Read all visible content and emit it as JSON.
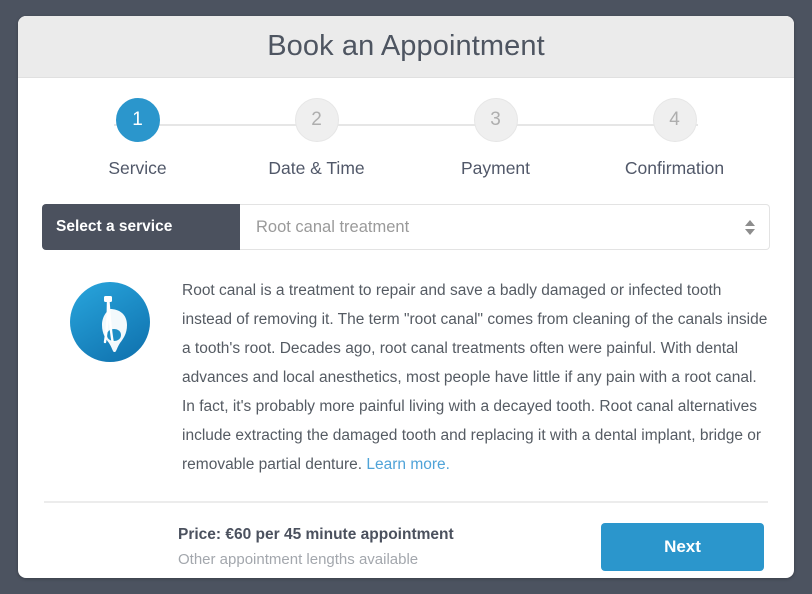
{
  "window": {
    "background_color": "#4c5360",
    "card_background": "#ffffff"
  },
  "header": {
    "title": "Book an Appointment",
    "background_color": "#ebebeb"
  },
  "stepper": {
    "active_color": "#2b96cc",
    "inactive_color": "#efefef",
    "steps": [
      {
        "number": "1",
        "label": "Service",
        "state": "active"
      },
      {
        "number": "2",
        "label": "Date & Time",
        "state": "inactive"
      },
      {
        "number": "3",
        "label": "Payment",
        "state": "inactive"
      },
      {
        "number": "4",
        "label": "Confirmation",
        "state": "inactive"
      }
    ]
  },
  "service_selector": {
    "label": "Select a service",
    "selected_value": "Root canal treatment",
    "placeholder": "Root canal treatment",
    "dropdown_icon": "up-down-arrows-icon",
    "label_background": "#4b515e"
  },
  "service_detail": {
    "icon_name": "tooth-root-canal-icon",
    "icon_color": "#2b96cc",
    "description": "Root canal is a treatment to repair and save a badly damaged or infected tooth instead of removing it. The term \"root canal\" comes from cleaning of the canals inside a tooth's root. Decades ago, root canal treatments often were painful. With dental advances and local anesthetics, most people have little if any pain with a root canal. In fact, it's probably more painful living with a decayed tooth. Root canal alternatives include extracting the damaged tooth and replacing it with a dental implant, bridge or removable partial denture. ",
    "learn_more_label": "Learn more.",
    "learn_more_color": "#4fa3d8"
  },
  "footer": {
    "price_text": "Price: €60 per 45 minute appointment",
    "price_note": "Other appointment lengths available",
    "next_label": "Next",
    "next_color": "#2b96cc"
  }
}
